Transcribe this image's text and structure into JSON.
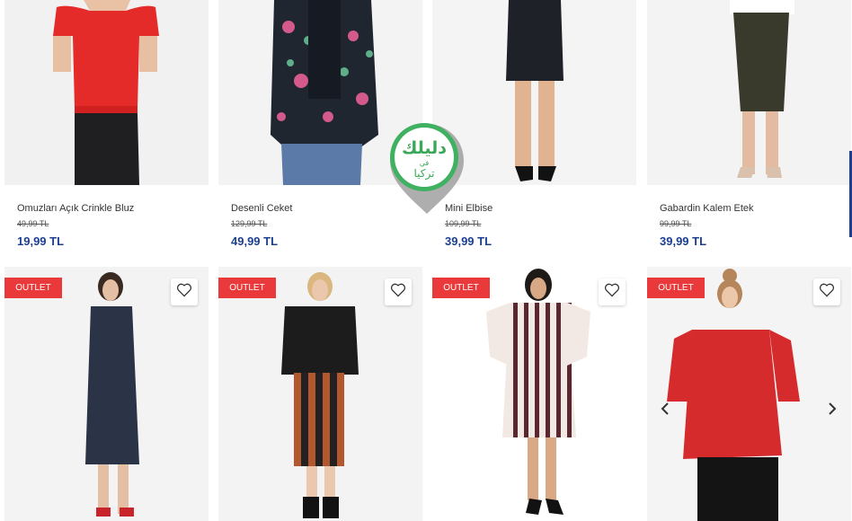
{
  "products_top": [
    {
      "title": "Omuzları Açık Crinkle Bluz",
      "old_price": "49,99 TL",
      "price": "19,99 TL"
    },
    {
      "title": "Desenli Ceket",
      "old_price": "129,99 TL",
      "price": "49,99 TL"
    },
    {
      "title": "Mini Elbise",
      "old_price": "109,99 TL",
      "price": "39,99 TL"
    },
    {
      "title": "Gabardin Kalem Etek",
      "old_price": "99,99 TL",
      "price": "39,99 TL"
    }
  ],
  "products_bottom": [
    {
      "badge": "OUTLET"
    },
    {
      "badge": "OUTLET"
    },
    {
      "badge": "OUTLET"
    },
    {
      "badge": "OUTLET"
    }
  ],
  "watermark": {
    "line1": "دليلك",
    "line2": "في",
    "line3": "تركيا"
  },
  "icons": {
    "favorite": "heart-icon",
    "prev": "chevron-left-icon",
    "next": "chevron-right-icon"
  },
  "colors": {
    "price": "#1c3f94",
    "outlet": "#e9393a",
    "watermark_green": "#3aa859"
  }
}
